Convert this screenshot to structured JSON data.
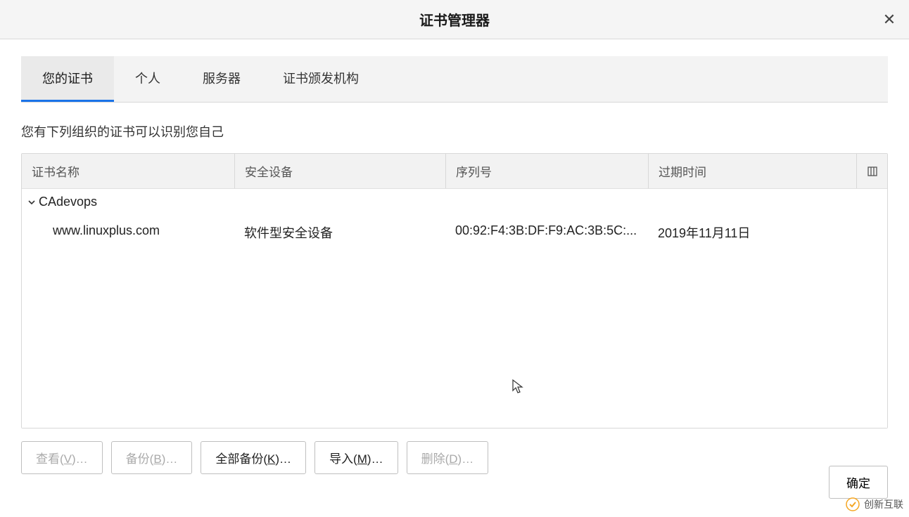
{
  "dialog": {
    "title": "证书管理器",
    "close": "✕"
  },
  "tabs": {
    "items": [
      {
        "label": "您的证书",
        "active": true
      },
      {
        "label": "个人",
        "active": false
      },
      {
        "label": "服务器",
        "active": false
      },
      {
        "label": "证书颁发机构",
        "active": false
      }
    ]
  },
  "subtitle": "您有下列组织的证书可以识别您自己",
  "table": {
    "headers": {
      "name": "证书名称",
      "device": "安全设备",
      "serial": "序列号",
      "expiry": "过期时间"
    },
    "menu_icon": "⧉",
    "group": {
      "chev": "⌄",
      "name": "CAdevops"
    },
    "rows": [
      {
        "name": "www.linuxplus.com",
        "device": "软件型安全设备",
        "serial": "00:92:F4:3B:DF:F9:AC:3B:5C:...",
        "expiry": "2019年11月11日"
      }
    ]
  },
  "buttons": {
    "view_prefix": "查看(",
    "view_u": "V",
    "view_suffix": ")…",
    "backup_prefix": "备份(",
    "backup_u": "B",
    "backup_suffix": ")…",
    "backup_all_prefix": "全部备份(",
    "backup_all_u": "K",
    "backup_all_suffix": ")…",
    "import_prefix": "导入(",
    "import_u": "M",
    "import_suffix": ")…",
    "delete_prefix": "删除(",
    "delete_u": "D",
    "delete_suffix": ")…"
  },
  "footer": {
    "ok": "确定"
  },
  "watermark": {
    "text": "创新互联"
  }
}
